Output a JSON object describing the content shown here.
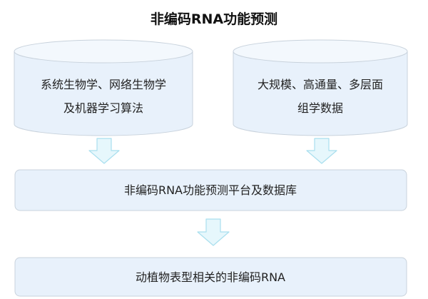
{
  "title": "非编码RNA功能预测",
  "inputs": [
    {
      "line1": "系统生物学、网络生物学",
      "line2": "及机器学习算法"
    },
    {
      "line1": "大规模、高通量、多层面",
      "line2": "组学数据"
    }
  ],
  "platform": {
    "label": "非编码RNA功能预测平台及数据库"
  },
  "output": {
    "label": "动植物表型相关的非编码RNA"
  },
  "colors": {
    "box_fill": "#e8f1fb",
    "box_border": "#c8d2dc",
    "arrow_fill": "#e6f7fc",
    "arrow_border": "#a9dfee"
  }
}
